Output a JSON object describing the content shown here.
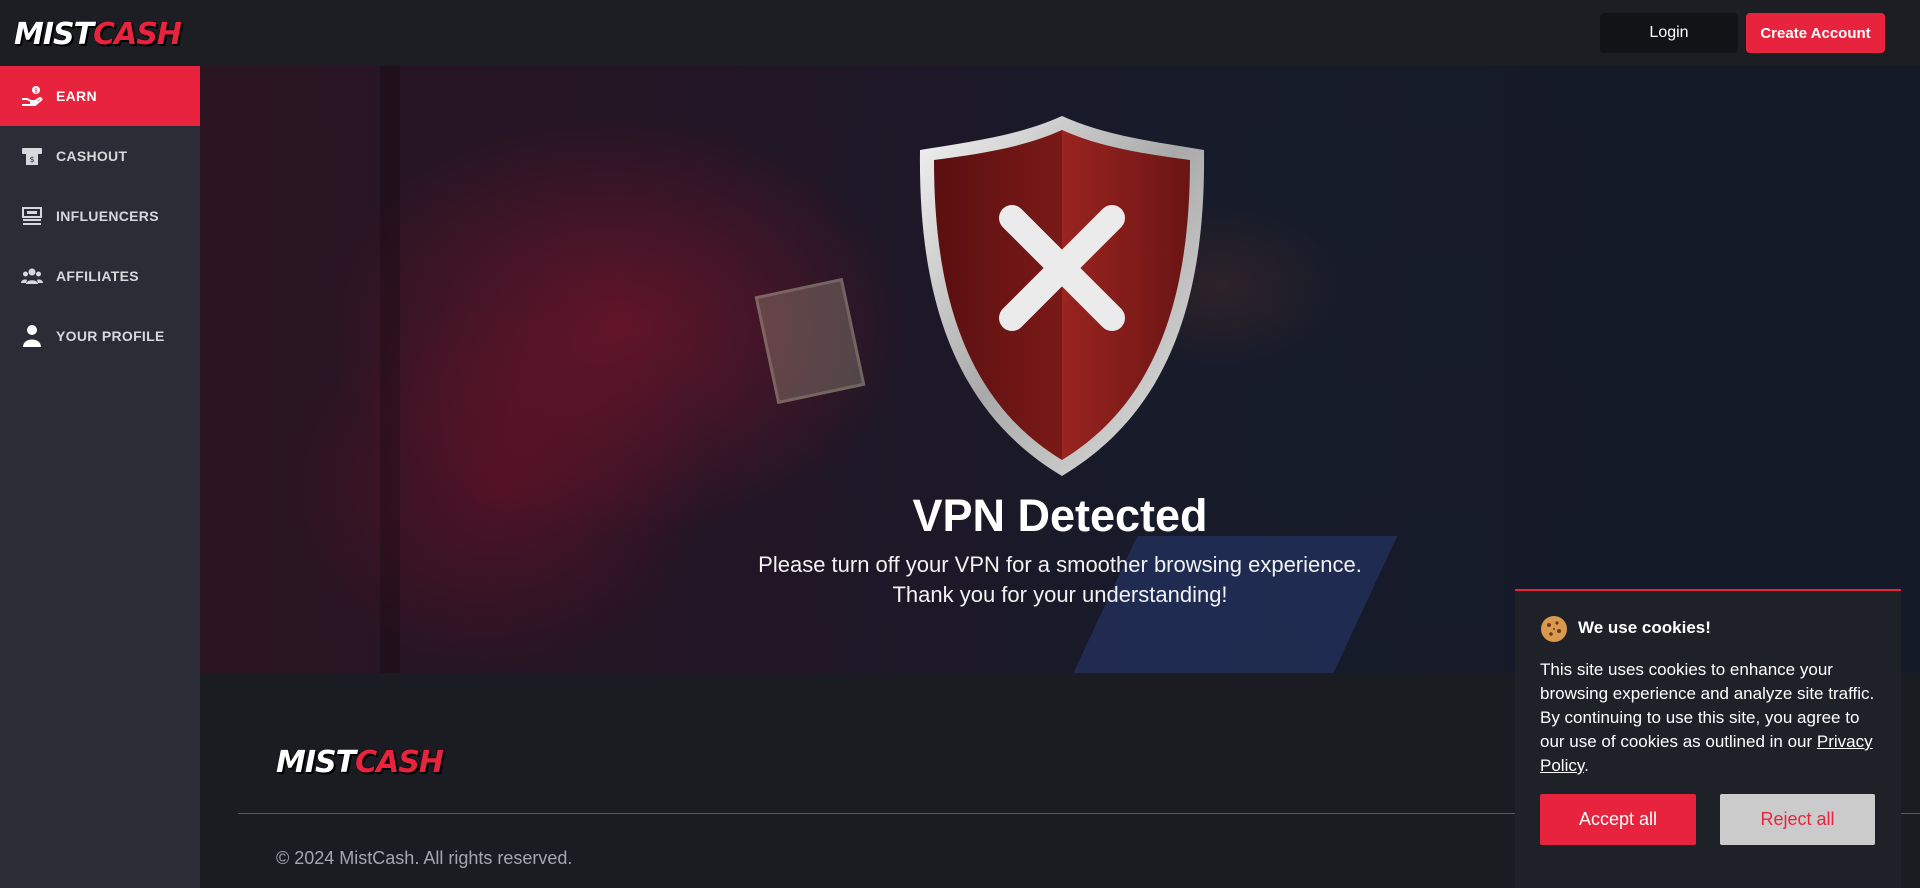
{
  "brand": {
    "logo_white": "MIST",
    "logo_red": "CASH",
    "accent": "#e8233d"
  },
  "header": {
    "login_label": "Login",
    "create_account_label": "Create Account"
  },
  "sidebar": {
    "items": [
      {
        "label": "EARN",
        "icon": "hand-coin-icon",
        "active": true
      },
      {
        "label": "CASHOUT",
        "icon": "cashout-icon",
        "active": false
      },
      {
        "label": "INFLUENCERS",
        "icon": "influencer-icon",
        "active": false
      },
      {
        "label": "AFFILIATES",
        "icon": "users-icon",
        "active": false
      },
      {
        "label": "YOUR PROFILE",
        "icon": "user-icon",
        "active": false
      }
    ]
  },
  "main": {
    "title": "VPN Detected",
    "line1": "Please turn off your VPN for a smoother browsing experience.",
    "line2": "Thank you for your understanding!",
    "illustration": "shield-x-icon"
  },
  "footer": {
    "copyright": "© 2024 MistCash. All rights reserved."
  },
  "cookie": {
    "title": "We use cookies!",
    "text": "This site uses cookies to enhance your browsing experience and analyze site traffic. By continuing to use this site, you agree to our use of cookies as outlined in our",
    "link": "Privacy Policy",
    "end": ".",
    "accept_label": "Accept all",
    "reject_label": "Reject all"
  }
}
